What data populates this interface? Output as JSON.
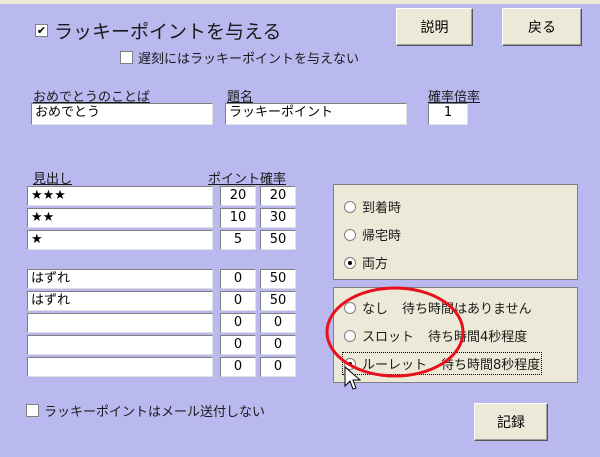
{
  "main_checkbox": {
    "checked": true,
    "label": "ラッキーポイントを与える"
  },
  "late_checkbox": {
    "checked": false,
    "label": "遅刻にはラッキーポイントを与えない"
  },
  "buttons": {
    "help": "説明",
    "back": "戻る",
    "save": "記録"
  },
  "fields": {
    "congrats_label": "おめでとうのことば",
    "congrats_value": "おめでとう",
    "title_label": "題名",
    "title_value": "ラッキーポイント",
    "multiplier_label": "確率倍率",
    "multiplier_value": "1"
  },
  "table": {
    "headers": {
      "heading": "見出し",
      "points": "ポイント",
      "prob": "確率"
    },
    "rows": [
      {
        "label": "★★★",
        "points": "20",
        "prob": "20"
      },
      {
        "label": "★★",
        "points": "10",
        "prob": "30"
      },
      {
        "label": "★",
        "points": "5",
        "prob": "50"
      },
      {
        "label": "はずれ",
        "points": "0",
        "prob": "50"
      },
      {
        "label": "はずれ",
        "points": "0",
        "prob": "50"
      },
      {
        "label": "",
        "points": "0",
        "prob": "0"
      },
      {
        "label": "",
        "points": "0",
        "prob": "0"
      },
      {
        "label": "",
        "points": "0",
        "prob": "0"
      }
    ]
  },
  "timing_options": [
    {
      "label": "到着時",
      "selected": false
    },
    {
      "label": "帰宅時",
      "selected": false
    },
    {
      "label": "両方",
      "selected": true
    }
  ],
  "effect_options": [
    {
      "label": "なし",
      "desc": "待ち時間はありません",
      "selected": false
    },
    {
      "label": "スロット",
      "desc": "待ち時間4秒程度",
      "selected": false
    },
    {
      "label": "ルーレット",
      "desc": "待ち時間8秒程度",
      "selected": true
    }
  ],
  "mail_checkbox": {
    "checked": false,
    "label": "ラッキーポイントはメール送付しない"
  },
  "annotation_color": "#e8101a"
}
